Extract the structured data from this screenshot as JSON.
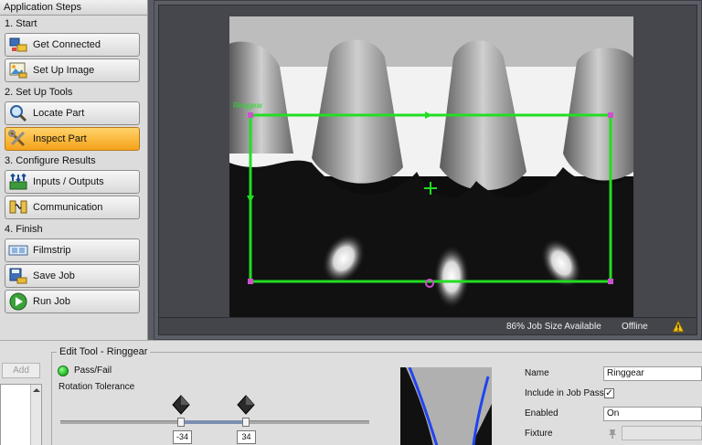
{
  "steps_panel": {
    "title": "Application Steps",
    "sections": [
      {
        "label": "1. Start",
        "items": [
          {
            "label": "Get Connected",
            "icon": "plug-connect-icon"
          },
          {
            "label": "Set Up Image",
            "icon": "image-setup-icon"
          }
        ]
      },
      {
        "label": "2. Set Up Tools",
        "items": [
          {
            "label": "Locate Part",
            "icon": "magnifier-icon"
          },
          {
            "label": "Inspect Part",
            "icon": "tools-icon",
            "active": true
          }
        ]
      },
      {
        "label": "3. Configure Results",
        "items": [
          {
            "label": "Inputs / Outputs",
            "icon": "io-arrows-icon"
          },
          {
            "label": "Communication",
            "icon": "communication-icon"
          }
        ]
      },
      {
        "label": "4. Finish",
        "items": [
          {
            "label": "Filmstrip",
            "icon": "filmstrip-icon"
          },
          {
            "label": "Save Job",
            "icon": "save-job-icon"
          },
          {
            "label": "Run Job",
            "icon": "play-icon"
          }
        ]
      }
    ]
  },
  "viewer": {
    "region_label": "Ringgear",
    "status": {
      "job_size": "86% Job Size Available",
      "connection": "Offline",
      "warning_icon": "warning-icon"
    }
  },
  "bottom": {
    "add_button": "Add",
    "group_title": "Edit Tool - Ringgear",
    "pass_fail_label": "Pass/Fail",
    "rotation_label": "Rotation Tolerance",
    "rotation_min": "-34",
    "rotation_max": "34",
    "properties": {
      "name_label": "Name",
      "name_value": "Ringgear",
      "include_label": "Include in Job Pass",
      "include_checked": "✓",
      "enabled_label": "Enabled",
      "enabled_value": "On",
      "fixture_label": "Fixture",
      "fixture_value": ""
    }
  },
  "colors": {
    "accent_active": "#f4a21a",
    "roi_green": "#22dd22",
    "pass_green": "#1fb31f"
  }
}
